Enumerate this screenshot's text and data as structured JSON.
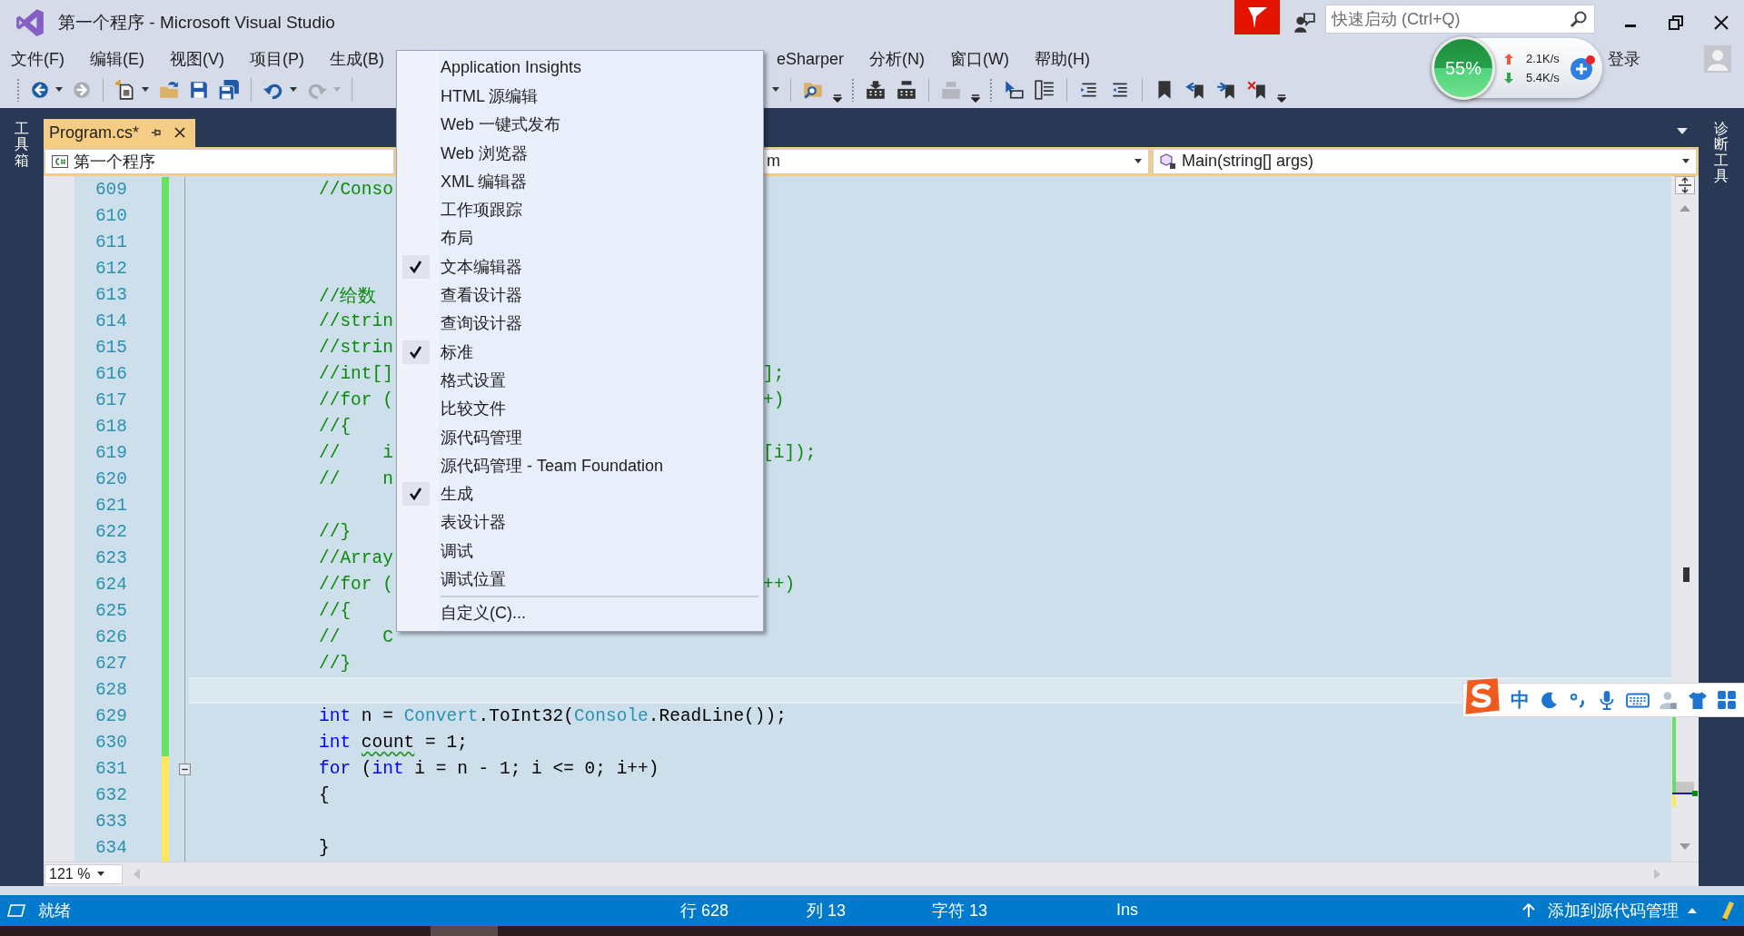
{
  "window": {
    "title": "第一个程序 - Microsoft Visual Studio"
  },
  "quick_launch": {
    "placeholder": "快速启动 (Ctrl+Q)"
  },
  "menubar": {
    "left": [
      "文件(F)",
      "编辑(E)",
      "视图(V)",
      "项目(P)",
      "生成(B)"
    ],
    "right": [
      "eSharper",
      "分析(N)",
      "窗口(W)",
      "帮助(H)"
    ],
    "sign_in": "登录"
  },
  "network_widget": {
    "percent": "55%",
    "upload": "2.1K/s",
    "download": "5.4K/s"
  },
  "side_panels": {
    "left": "工具箱",
    "right": "诊断工具"
  },
  "tab": {
    "label": "Program.cs*",
    "selected": true
  },
  "navbar": {
    "project": "第一个程序",
    "type": "m",
    "member": "Main(string[] args)"
  },
  "code_lines": [
    {
      "number": "609",
      "color": "#68e068",
      "current": false,
      "fold": false,
      "tokens": [
        {
          "text": "//Conso",
          "kind": "comment"
        }
      ]
    },
    {
      "number": "610",
      "color": "#68e068",
      "current": false,
      "fold": false
    },
    {
      "number": "611",
      "color": "#68e068",
      "current": false,
      "fold": false
    },
    {
      "number": "612",
      "color": "#68e068",
      "current": false,
      "fold": false
    },
    {
      "number": "613",
      "color": "#68e068",
      "current": false,
      "fold": false,
      "tokens": [
        {
          "text": "//给数",
          "kind": "comment"
        }
      ]
    },
    {
      "number": "614",
      "color": "#68e068",
      "current": false,
      "fold": false,
      "tokens": [
        {
          "text": "//strin",
          "kind": "comment"
        }
      ]
    },
    {
      "number": "615",
      "color": "#68e068",
      "current": false,
      "fold": false,
      "tokens": [
        {
          "text": "//strin",
          "kind": "comment"
        }
      ]
    },
    {
      "number": "616",
      "color": "#68e068",
      "current": false,
      "fold": false,
      "tokens": [
        {
          "text": "//int[]",
          "kind": "comment"
        }
      ],
      "tail": "];"
    },
    {
      "number": "617",
      "color": "#68e068",
      "current": false,
      "fold": false,
      "tokens": [
        {
          "text": "//for (",
          "kind": "comment"
        }
      ],
      "tail": "+)"
    },
    {
      "number": "618",
      "color": "#68e068",
      "current": false,
      "fold": false,
      "tokens": [
        {
          "text": "//{",
          "kind": "comment"
        }
      ]
    },
    {
      "number": "619",
      "color": "#68e068",
      "current": false,
      "fold": false,
      "tokens": [
        {
          "text": "//    i",
          "kind": "comment"
        }
      ],
      "tail": "[i]);"
    },
    {
      "number": "620",
      "color": "#68e068",
      "current": false,
      "fold": false,
      "tokens": [
        {
          "text": "//    n",
          "kind": "comment"
        }
      ]
    },
    {
      "number": "621",
      "color": "#68e068",
      "current": false,
      "fold": false
    },
    {
      "number": "622",
      "color": "#68e068",
      "current": false,
      "fold": false,
      "tokens": [
        {
          "text": "//}",
          "kind": "comment"
        }
      ]
    },
    {
      "number": "623",
      "color": "#68e068",
      "current": false,
      "fold": false,
      "tokens": [
        {
          "text": "//Array",
          "kind": "comment"
        }
      ]
    },
    {
      "number": "624",
      "color": "#68e068",
      "current": false,
      "fold": false,
      "tokens": [
        {
          "text": "//for (",
          "kind": "comment"
        }
      ],
      "tail": "++)"
    },
    {
      "number": "625",
      "color": "#68e068",
      "current": false,
      "fold": false,
      "tokens": [
        {
          "text": "//{",
          "kind": "comment"
        }
      ]
    },
    {
      "number": "626",
      "color": "#68e068",
      "current": false,
      "fold": false,
      "tokens": [
        {
          "text": "//    C",
          "kind": "comment"
        }
      ]
    },
    {
      "number": "627",
      "color": "#68e068",
      "current": false,
      "fold": false,
      "tokens": [
        {
          "text": "//}",
          "kind": "comment"
        }
      ]
    },
    {
      "number": "628",
      "color": "#68e068",
      "current": true,
      "fold": false
    },
    {
      "number": "629",
      "color": "#68e068",
      "current": false,
      "fold": false,
      "tokens": [
        {
          "text": "int",
          "kind": "keyword"
        },
        {
          "text": " n = ",
          "kind": "plain"
        },
        {
          "text": "Convert",
          "kind": "type"
        },
        {
          "text": ".ToInt32(",
          "kind": "plain"
        },
        {
          "text": "Console",
          "kind": "type"
        },
        {
          "text": ".ReadLine());",
          "kind": "plain"
        }
      ]
    },
    {
      "number": "630",
      "color": "#68e068",
      "current": false,
      "fold": false,
      "tokens": [
        {
          "text": "int ",
          "kind": "keyword"
        },
        {
          "text": "count",
          "kind": "warning"
        },
        {
          "text": " = 1;",
          "kind": "plain"
        }
      ]
    },
    {
      "number": "631",
      "color": "#fbe95b",
      "current": false,
      "fold": true,
      "tokens": [
        {
          "text": "for",
          "kind": "keyword"
        },
        {
          "text": " (",
          "kind": "plain"
        },
        {
          "text": "int",
          "kind": "keyword"
        },
        {
          "text": " i = n - 1; i <= 0; i++)",
          "kind": "plain"
        }
      ]
    },
    {
      "number": "632",
      "color": "#fbe95b",
      "current": false,
      "fold": false,
      "tokens": [
        {
          "text": "{",
          "kind": "plain"
        }
      ]
    },
    {
      "number": "633",
      "color": "#fbe95b",
      "current": false,
      "fold": false
    },
    {
      "number": "634",
      "color": "#fbe95b",
      "current": false,
      "fold": false,
      "tokens": [
        {
          "text": "}",
          "kind": "plain"
        }
      ]
    }
  ],
  "zoom": {
    "value": "121 %"
  },
  "dropdown": {
    "items": [
      {
        "label": "Application Insights",
        "kind": "toggle",
        "checked": false
      },
      {
        "label": "HTML 源编辑",
        "kind": "toggle",
        "checked": false
      },
      {
        "label": "Web 一键式发布",
        "kind": "toggle",
        "checked": false
      },
      {
        "label": "Web 浏览器",
        "kind": "toggle",
        "checked": false
      },
      {
        "label": "XML 编辑器",
        "kind": "toggle",
        "checked": false
      },
      {
        "label": "工作项跟踪",
        "kind": "toggle",
        "checked": false
      },
      {
        "label": "布局",
        "kind": "toggle",
        "checked": false
      },
      {
        "label": "文本编辑器",
        "kind": "toggle",
        "checked": true
      },
      {
        "label": "查看设计器",
        "kind": "toggle",
        "checked": false
      },
      {
        "label": "查询设计器",
        "kind": "toggle",
        "checked": false
      },
      {
        "label": "标准",
        "kind": "toggle",
        "checked": true
      },
      {
        "label": "格式设置",
        "kind": "toggle",
        "checked": false
      },
      {
        "label": "比较文件",
        "kind": "toggle",
        "checked": false
      },
      {
        "label": "源代码管理",
        "kind": "toggle",
        "checked": false
      },
      {
        "label": "源代码管理 - Team Foundation",
        "kind": "toggle",
        "checked": false
      },
      {
        "label": "生成",
        "kind": "toggle",
        "checked": true
      },
      {
        "label": "表设计器",
        "kind": "toggle",
        "checked": false
      },
      {
        "label": "调试",
        "kind": "toggle",
        "checked": false
      },
      {
        "label": "调试位置",
        "kind": "toggle",
        "checked": false
      },
      {
        "label": "自定义(C)...",
        "kind": "command",
        "checked": false
      }
    ]
  },
  "ime_toolbar": {
    "mode": "中"
  },
  "status_bar": {
    "ready": "就绪",
    "line": "行 628",
    "column": "列 13",
    "character": "字符 13",
    "mode": "Ins",
    "source_control": "添加到源代码管理"
  }
}
